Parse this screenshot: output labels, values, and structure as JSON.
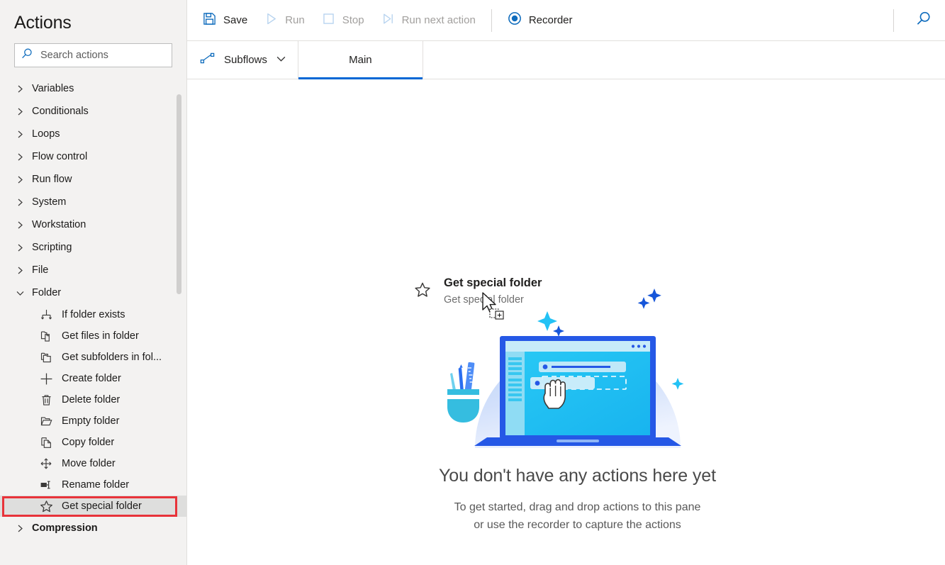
{
  "sidebar": {
    "title": "Actions",
    "search": {
      "placeholder": "Search actions",
      "value": "",
      "icon": "search-icon"
    },
    "groups": [
      {
        "label": "Variables",
        "expanded": false
      },
      {
        "label": "Conditionals",
        "expanded": false
      },
      {
        "label": "Loops",
        "expanded": false
      },
      {
        "label": "Flow control",
        "expanded": false
      },
      {
        "label": "Run flow",
        "expanded": false
      },
      {
        "label": "System",
        "expanded": false
      },
      {
        "label": "Workstation",
        "expanded": false
      },
      {
        "label": "Scripting",
        "expanded": false
      },
      {
        "label": "File",
        "expanded": false
      },
      {
        "label": "Folder",
        "expanded": true
      },
      {
        "label": "Compression",
        "expanded": false
      }
    ],
    "folder_items": [
      {
        "label": "If folder exists",
        "icon": "if-folder-exists-icon",
        "selected": false
      },
      {
        "label": "Get files in folder",
        "icon": "get-files-in-folder-icon",
        "selected": false
      },
      {
        "label": "Get subfolders in fol...",
        "icon": "get-subfolders-icon",
        "selected": false
      },
      {
        "label": "Create folder",
        "icon": "plus-icon",
        "selected": false
      },
      {
        "label": "Delete folder",
        "icon": "trash-icon",
        "selected": false
      },
      {
        "label": "Empty folder",
        "icon": "open-folder-icon",
        "selected": false
      },
      {
        "label": "Copy folder",
        "icon": "copy-icon",
        "selected": false
      },
      {
        "label": "Move folder",
        "icon": "move-arrows-icon",
        "selected": false
      },
      {
        "label": "Rename folder",
        "icon": "rename-icon",
        "selected": false
      },
      {
        "label": "Get special folder",
        "icon": "star-icon",
        "selected": true
      }
    ],
    "highlight_color": "#e8333a"
  },
  "toolbar": {
    "save_label": "Save",
    "run_label": "Run",
    "stop_label": "Stop",
    "run_next_label": "Run next action",
    "recorder_label": "Recorder",
    "search_icon": "search-icon",
    "accent_color": "#0067d5"
  },
  "tabs": {
    "subflows_label": "Subflows",
    "items": [
      {
        "label": "Main",
        "active": true
      }
    ]
  },
  "canvas": {
    "drag_ghost": {
      "title": "Get special folder",
      "subtitle": "Get special folder",
      "icon": "star-icon"
    },
    "empty_state": {
      "title": "You don't have any actions here yet",
      "line1": "To get started, drag and drop actions to this pane",
      "line2": "or use the recorder to capture the actions",
      "illustration": "laptop-drag-drop-illustration"
    }
  }
}
